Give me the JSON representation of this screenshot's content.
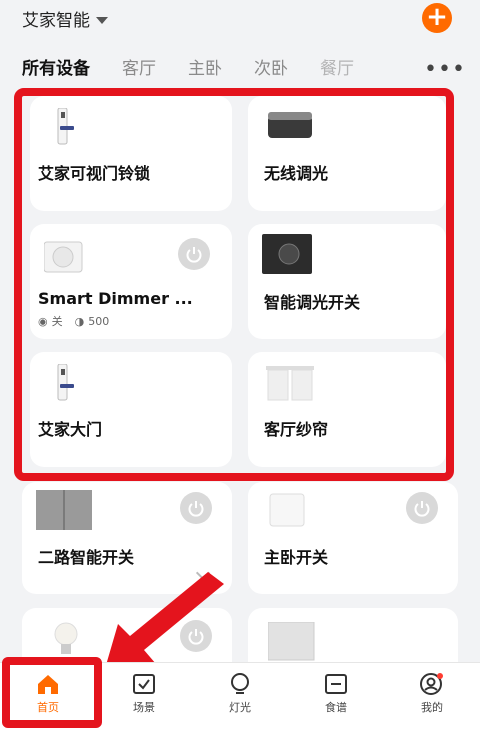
{
  "header": {
    "home_name": "艾家智能",
    "add_icon": "plus-icon",
    "accent": "#ff6a00"
  },
  "tabs": [
    "所有设备",
    "客厅",
    "主卧",
    "次卧",
    "餐厅"
  ],
  "more_label": "•••",
  "devices": [
    {
      "name": "艾家可视门铃锁",
      "icon": "door-lock-icon"
    },
    {
      "name": "无线调光",
      "icon": "dimmer-knob-icon"
    },
    {
      "name": "Smart Dimmer ...",
      "icon": "smart-dimmer-icon",
      "power_button": true,
      "status_mode": "关",
      "status_value": "500"
    },
    {
      "name": "智能调光开关",
      "icon": "dimmer-switch-icon"
    },
    {
      "name": "艾家大门",
      "icon": "door-lock-icon"
    },
    {
      "name": "客厅纱帘",
      "icon": "curtain-icon"
    },
    {
      "name": "二路智能开关",
      "icon": "two-way-switch-icon",
      "power_button": true
    },
    {
      "name": "主卧开关",
      "icon": "wall-switch-icon",
      "power_button": true
    },
    {
      "name": "",
      "icon": "smart-bulb-icon",
      "power_button": true
    },
    {
      "name": "",
      "icon": "panel-switch-icon"
    }
  ],
  "nav": [
    {
      "label": "首页",
      "icon": "home-icon",
      "active": true
    },
    {
      "label": "场景",
      "icon": "scene-icon"
    },
    {
      "label": "灯光",
      "icon": "light-bulb-icon"
    },
    {
      "label": "食谱",
      "icon": "recipe-icon"
    },
    {
      "label": "我的",
      "icon": "profile-icon"
    }
  ],
  "annotation_color": "#e4141d"
}
